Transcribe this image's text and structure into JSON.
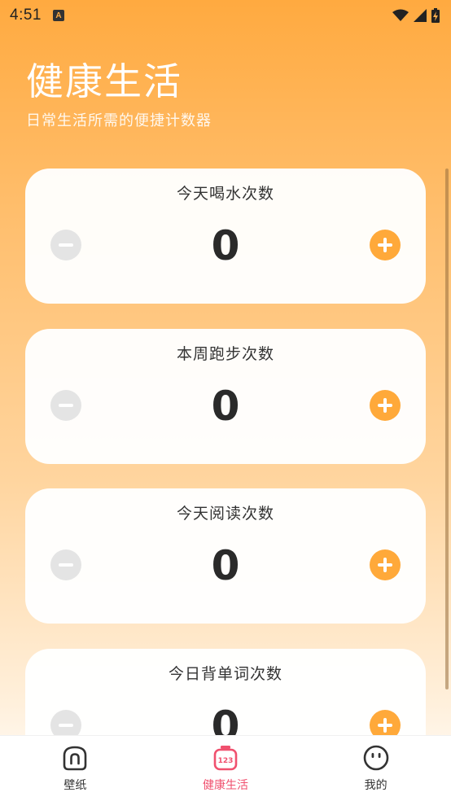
{
  "status_bar": {
    "time": "4:51",
    "app_icon_letter": "A"
  },
  "header": {
    "title": "健康生活",
    "subtitle": "日常生活所需的便捷计数器"
  },
  "counters": [
    {
      "label": "今天喝水次数",
      "value": "0"
    },
    {
      "label": "本周跑步次数",
      "value": "0"
    },
    {
      "label": "今天阅读次数",
      "value": "0"
    },
    {
      "label": "今日背单词次数",
      "value": "0"
    }
  ],
  "bottom_nav": [
    {
      "label": "壁纸",
      "icon": "wallpaper-icon",
      "active": false
    },
    {
      "label": "健康生活",
      "icon": "counter-123-icon",
      "active": true
    },
    {
      "label": "我的",
      "icon": "profile-face-icon",
      "active": false
    }
  ],
  "colors": {
    "accent": "#ffa93a",
    "active_nav": "#f0506e",
    "minus_button": "#e4e4e4"
  }
}
